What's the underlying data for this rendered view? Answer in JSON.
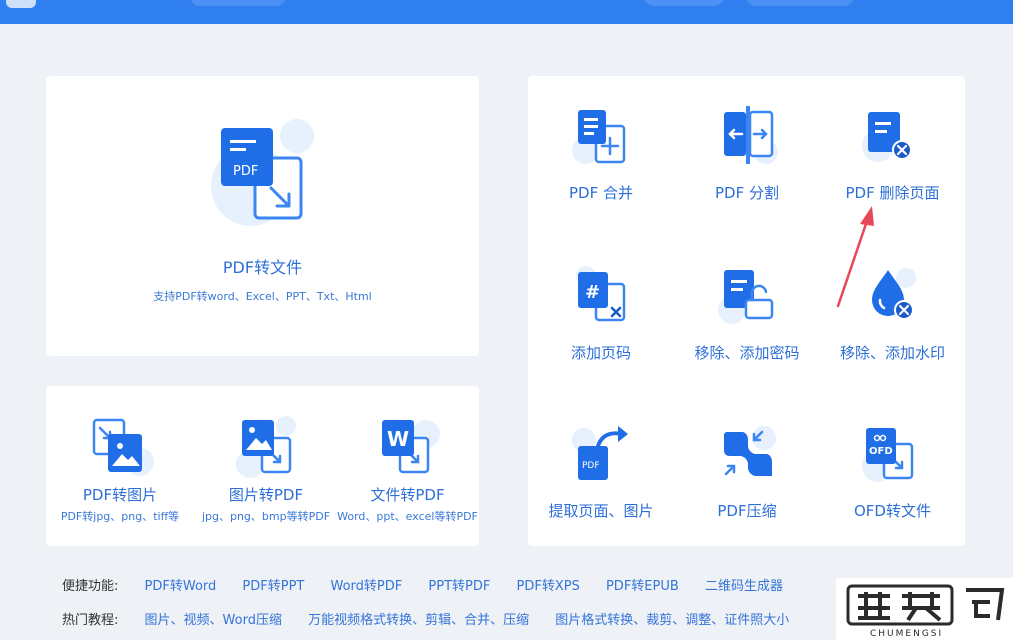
{
  "converters": {
    "pdf_to_file": {
      "label": "PDF转文件",
      "desc": "支持PDF转word、Excel、PPT、Txt、Html",
      "badge": "PDF"
    },
    "pdf_to_image": {
      "label": "PDF转图片",
      "desc": "PDF转jpg、png、tiff等"
    },
    "image_to_pdf": {
      "label": "图片转PDF",
      "desc": "jpg、png、bmp等转PDF"
    },
    "file_to_pdf": {
      "label": "文件转PDF",
      "desc": "Word、ppt、excel等转PDF"
    }
  },
  "tools": [
    {
      "label": "PDF 合并"
    },
    {
      "label": "PDF 分割"
    },
    {
      "label": "PDF 删除页面"
    },
    {
      "label": "添加页码"
    },
    {
      "label": "移除、添加密码"
    },
    {
      "label": "移除、添加水印"
    },
    {
      "label": "提取页面、图片"
    },
    {
      "label": "PDF压缩"
    },
    {
      "label": "OFD转文件"
    }
  ],
  "quick": {
    "heading": "便捷功能:",
    "items": [
      "PDF转Word",
      "PDF转PPT",
      "Word转PDF",
      "PPT转PDF",
      "PDF转XPS",
      "PDF转EPUB",
      "二维码生成器"
    ]
  },
  "tutorials": {
    "heading": "热门教程:",
    "items": [
      "图片、视频、Word压缩",
      "万能视频格式转换、剪辑、合并、压缩",
      "图片格式转换、裁剪、调整、证件照大小"
    ]
  },
  "icon_labels": {
    "pdf_badge": "PDF",
    "word_badge": "W",
    "ofd_badge": "OFD",
    "hash": "#"
  },
  "watermark": {
    "brand": "CHUMENGSI"
  },
  "colors": {
    "accent": "#2f7ff0",
    "text_blue": "#2d6fd8",
    "arrow": "#e8475a"
  }
}
